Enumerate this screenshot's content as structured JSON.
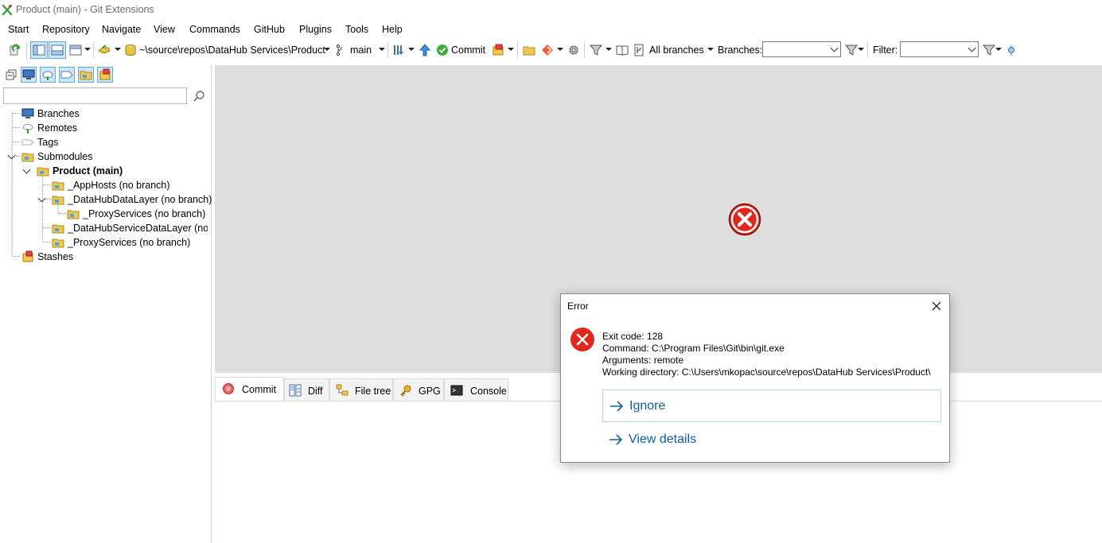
{
  "window": {
    "title": "Product (main) - Git Extensions"
  },
  "menu": [
    "Start",
    "Repository",
    "Navigate",
    "View",
    "Commands",
    "GitHub",
    "Plugins",
    "Tools",
    "Help"
  ],
  "toolbar": {
    "repo_path": "~\\source\\repos\\DataHub Services\\Product",
    "branch": "main",
    "commit_label": "Commit",
    "all_branches_label": "All branches",
    "branches_label": "Branches:",
    "branches_value": "",
    "filter_label": "Filter:",
    "filter_value": ""
  },
  "left_panel": {
    "search_value": "",
    "tree": [
      {
        "label": "Branches",
        "icon": "branches-icon",
        "level": 0
      },
      {
        "label": "Remotes",
        "icon": "remotes-icon",
        "level": 0
      },
      {
        "label": "Tags",
        "icon": "tags-icon",
        "level": 0
      },
      {
        "label": "Submodules",
        "icon": "folder-icon",
        "level": 0,
        "expanded": true
      },
      {
        "label": "Product (main)",
        "icon": "folder-icon",
        "level": 1,
        "expanded": true,
        "bold": true
      },
      {
        "label": "_AppHosts (no branch)",
        "icon": "folder-icon",
        "level": 2
      },
      {
        "label": "_DataHubDataLayer (no branch)",
        "icon": "folder-icon",
        "level": 2,
        "expanded": true
      },
      {
        "label": "_ProxyServices (no branch)",
        "icon": "folder-icon",
        "level": 3
      },
      {
        "label": "_DataHubServiceDataLayer (no branch)",
        "icon": "folder-icon",
        "level": 2
      },
      {
        "label": "_ProxyServices (no branch)",
        "icon": "folder-icon",
        "level": 2
      },
      {
        "label": "Stashes",
        "icon": "stash-icon",
        "level": 0
      }
    ]
  },
  "tabs": [
    {
      "label": "Commit",
      "icon": "commit-icon",
      "active": true
    },
    {
      "label": "Diff",
      "icon": "diff-icon"
    },
    {
      "label": "File tree",
      "icon": "file-tree-icon"
    },
    {
      "label": "GPG",
      "icon": "key-icon"
    },
    {
      "label": "Console",
      "icon": "console-icon"
    }
  ],
  "dialog": {
    "title": "Error",
    "lines": [
      "Exit code: 128",
      "Command: C:\\Program Files\\Git\\bin\\git.exe",
      "Arguments: remote",
      "Working directory: C:\\Users\\mkopac\\source\\repos\\DataHub Services\\Product\\"
    ],
    "ignore_label": "Ignore",
    "details_label": "View details"
  },
  "colors": {
    "accent": "#0c5e9c",
    "error": "#d9261c",
    "graph_bg": "#dedede"
  }
}
